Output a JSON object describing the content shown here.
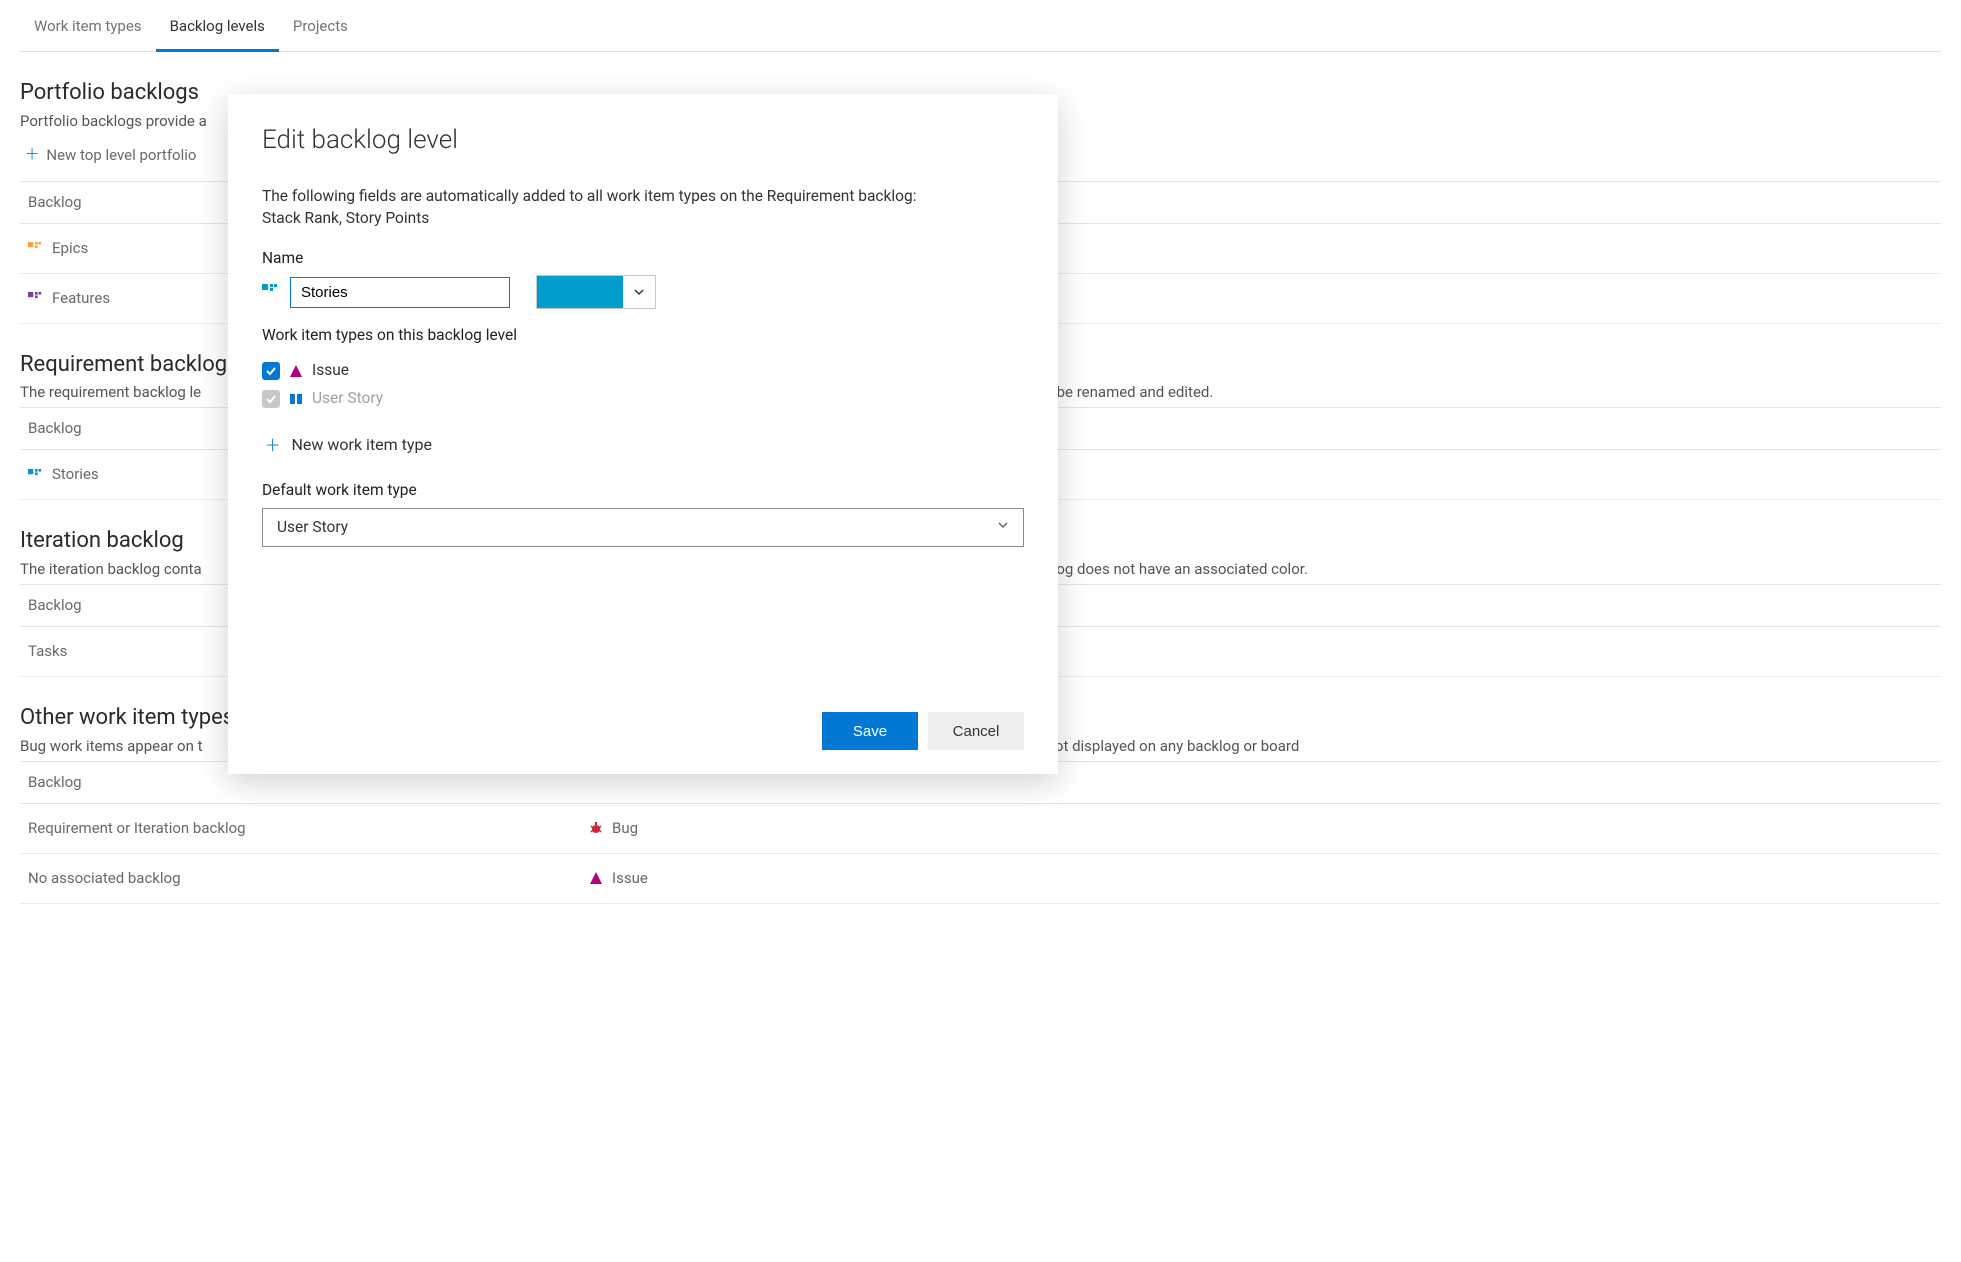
{
  "tabs": {
    "items": [
      "Work item types",
      "Backlog levels",
      "Projects"
    ],
    "selected_index": 1
  },
  "portfolio": {
    "title": "Portfolio backlogs",
    "desc": "Portfolio backlogs provide a",
    "add_label": "New top level portfolio",
    "header": "Backlog",
    "rows": [
      {
        "label": "Epics",
        "color": "#f2a23c"
      },
      {
        "label": "Features",
        "color": "#7b3f9e"
      }
    ]
  },
  "requirement": {
    "title": "Requirement backlog",
    "desc_prefix": "The requirement backlog le",
    "desc_suffix": "can be renamed and edited.",
    "header": "Backlog",
    "rows": [
      {
        "label": "Stories",
        "color": "#0099cc"
      }
    ]
  },
  "iteration": {
    "title": "Iteration backlog",
    "desc_prefix": "The iteration backlog conta",
    "desc_suffix": "acklog does not have an associated color.",
    "header": "Backlog",
    "rows": [
      {
        "label": "Tasks"
      }
    ]
  },
  "other": {
    "title": "Other work item types",
    "desc_prefix": "Bug work items appear on t",
    "desc_suffix": "re not displayed on any backlog or board",
    "header": "Backlog",
    "rows": [
      {
        "label": "Requirement or Iteration backlog",
        "wit": "Bug",
        "wit_color": "#cc2936",
        "wit_icon": "bug"
      },
      {
        "label": "No associated backlog",
        "wit": "Issue",
        "wit_color": "#b5007d",
        "wit_icon": "issue"
      }
    ]
  },
  "modal": {
    "title": "Edit backlog level",
    "info_l1": "The following fields are automatically added to all work item types on the Requirement backlog:",
    "info_l2": "Stack Rank, Story Points",
    "name_label": "Name",
    "name_value": "Stories",
    "color_value": "#009CCC",
    "wit_label": "Work item types on this backlog level",
    "wits": [
      {
        "label": "Issue",
        "checked": true,
        "disabled": false,
        "icon": "issue",
        "icon_color": "#b5007d"
      },
      {
        "label": "User Story",
        "checked": true,
        "disabled": true,
        "icon": "book",
        "icon_color": "#0078d4"
      }
    ],
    "new_wit_label": "New work item type",
    "default_label": "Default work item type",
    "default_value": "User Story",
    "save": "Save",
    "cancel": "Cancel"
  }
}
